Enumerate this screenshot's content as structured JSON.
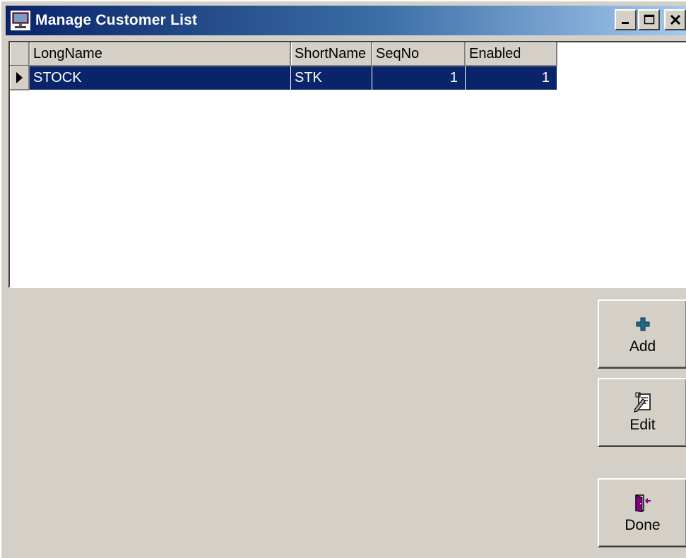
{
  "window": {
    "title": "Manage Customer List",
    "icon": "monitor-icon",
    "caption_buttons": {
      "minimize": "minimize-icon",
      "maximize": "maximize-icon",
      "close": "close-icon"
    }
  },
  "grid": {
    "columns": [
      "LongName",
      "ShortName",
      "SeqNo",
      "Enabled"
    ],
    "rows": [
      {
        "LongName": "STOCK",
        "ShortName": "STK",
        "SeqNo": "1",
        "Enabled": "1",
        "selected": true
      }
    ],
    "selection_color": "#0a246a"
  },
  "buttons": {
    "add": {
      "label": "Add",
      "icon": "plus-icon"
    },
    "edit": {
      "label": "Edit",
      "icon": "edit-document-icon"
    },
    "done": {
      "label": "Done",
      "icon": "exit-door-icon"
    }
  },
  "colors": {
    "face": "#d4d0c8",
    "title_gradient_start": "#0a246a",
    "title_gradient_end": "#a6caf0"
  }
}
